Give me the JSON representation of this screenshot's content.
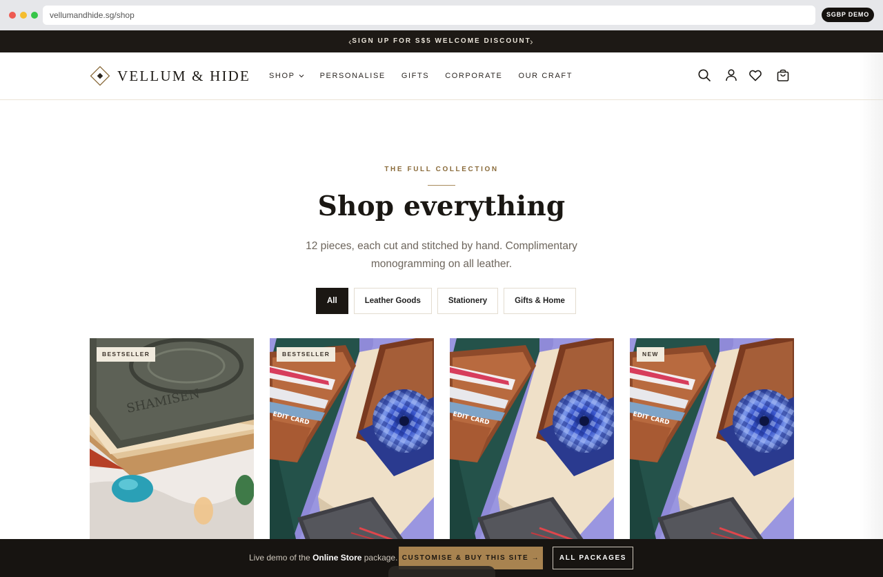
{
  "browser": {
    "url": "vellumandhide.sg/shop",
    "demo_pill": "SGBP DEMO"
  },
  "announcement": {
    "text": "SIGN UP FOR S$5 WELCOME DISCOUNT",
    "prev": "‹",
    "next": "›"
  },
  "header": {
    "brand": "VELLUM & HIDE",
    "nav": [
      {
        "label": "SHOP"
      },
      {
        "label": "PERSONALISE"
      },
      {
        "label": "GIFTS"
      },
      {
        "label": "CORPORATE"
      },
      {
        "label": "OUR CRAFT"
      }
    ],
    "icons": [
      "search-icon",
      "account-icon",
      "wishlist-heart-icon",
      "shopping-bag-icon"
    ]
  },
  "hero": {
    "eyebrow": "THE FULL COLLECTION",
    "title": "Shop everything",
    "subtitle": "12 pieces, each cut and stitched by hand. Complimentary monogramming on all leather."
  },
  "filters": [
    {
      "label": "All",
      "active": true
    },
    {
      "label": "Leather Goods",
      "active": false
    },
    {
      "label": "Stationery",
      "active": false
    },
    {
      "label": "Gifts & Home",
      "active": false
    }
  ],
  "products": [
    {
      "badge": "BESTSELLER",
      "image": "embossed-leather-journal"
    },
    {
      "badge": "BESTSELLER",
      "image": "leather-card-wallets"
    },
    {
      "badge": "",
      "image": "leather-card-wallets"
    },
    {
      "badge": "NEW",
      "image": "leather-card-wallets"
    }
  ],
  "demo_bar": {
    "prefix": "Live demo of the ",
    "package": "Online Store",
    "suffix": " package.",
    "buy_label": "CUSTOMISE & BUY THIS SITE →",
    "packages_label": "ALL PACKAGES"
  },
  "colors": {
    "accent_gold": "#a88350",
    "dark": "#1b1713",
    "eyebrow": "#8a6b3b"
  }
}
